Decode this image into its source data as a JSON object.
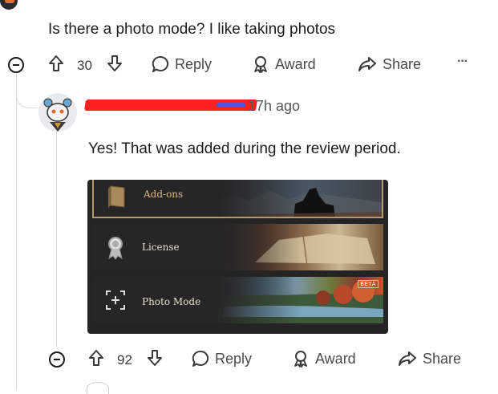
{
  "parent_comment": {
    "text": "Is there a photo mode? I like taking photos",
    "votes": "30",
    "actions": {
      "reply": "Reply",
      "award": "Award",
      "share": "Share",
      "more": "···"
    }
  },
  "reply_comment": {
    "timestamp": "17h ago",
    "text": "Yes! That was added during the review period.",
    "votes": "92",
    "actions": {
      "reply": "Reply",
      "award": "Award",
      "share": "Share"
    }
  },
  "game_menu": {
    "items": [
      {
        "label": "Add-ons",
        "icon": "book-icon",
        "selected": true
      },
      {
        "label": "License",
        "icon": "medal-icon"
      },
      {
        "label": "Photo Mode",
        "icon": "camera-frame-icon",
        "badge": "BETA"
      }
    ]
  },
  "colors": {
    "redaction": "#ff2020",
    "selected_border": "#b49a6a"
  }
}
